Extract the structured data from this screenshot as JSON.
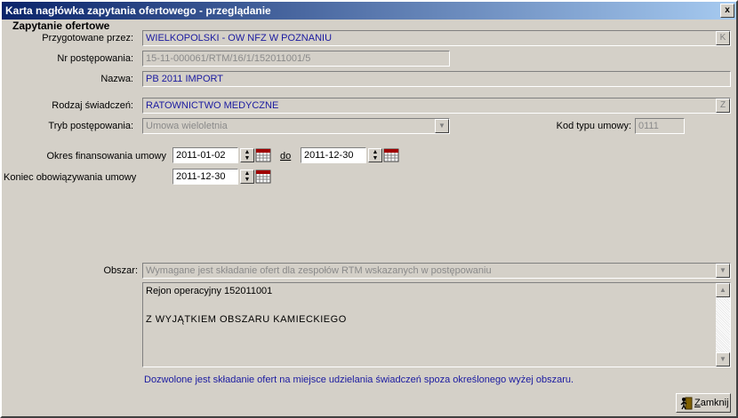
{
  "window": {
    "title": "Karta nagłówka zapytania ofertowego - przeglądanie",
    "close_glyph": "x"
  },
  "section": {
    "title": "Zapytanie ofertowe"
  },
  "form": {
    "prepared_by": {
      "label": "Przygotowane przez:",
      "value": "WIELKOPOLSKI  -  OW NFZ W POZNANIU",
      "button": "K"
    },
    "procedure_no": {
      "label": "Nr postępowania:",
      "value": "15-11-000061/RTM/16/1/152011001/5"
    },
    "name": {
      "label": "Nazwa:",
      "value": "PB 2011 IMPORT"
    },
    "service_type": {
      "label": "Rodzaj świadczeń:",
      "value": "RATOWNICTWO MEDYCZNE",
      "button": "Z"
    },
    "procedure_mode": {
      "label": "Tryb postępowania:",
      "value": "Umowa wieloletnia"
    },
    "contract_type_code": {
      "label": "Kod typu umowy:",
      "value": "0111"
    },
    "financing_period": {
      "label": "Okres finansowania umowy",
      "from": "2011-01-02",
      "to_label": "do",
      "to": "2011-12-30"
    },
    "contract_end": {
      "label": "Koniec obowiązywania umowy",
      "value": "2011-12-30"
    },
    "area": {
      "label": "Obszar:",
      "value": "Wymagane jest składanie ofert dla zespołów RTM wskazanych w postępowaniu",
      "lines": [
        "Rejon operacyjny 152011001",
        "",
        "Z WYJĄTKIEM OBSZARU KAMIECKIEGO"
      ]
    },
    "note": "Dozwolone jest składanie ofert na miejsce udzielania świadczeń spoza określonego wyżej obszaru."
  },
  "buttons": {
    "close_prefix": "Z",
    "close_rest": "amknij"
  },
  "colors": {
    "title_start": "#0a246a",
    "title_end": "#a6caf0",
    "value_text": "#1a1aa0",
    "face": "#d4d0c8"
  },
  "icons": [
    "close-icon",
    "calendar-icon",
    "spin-icon",
    "dropdown-arrow-icon",
    "scroll-up-icon",
    "scroll-down-icon",
    "close-door-icon"
  ]
}
